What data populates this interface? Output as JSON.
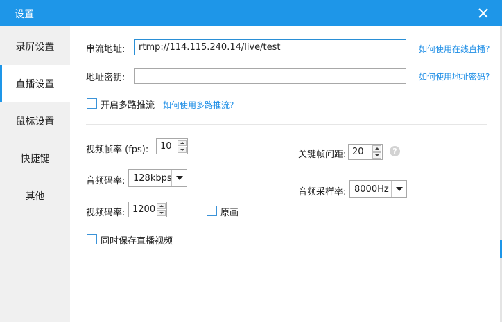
{
  "window": {
    "title": "设置"
  },
  "sidebar": {
    "items": [
      {
        "label": "录屏设置",
        "active": false
      },
      {
        "label": "直播设置",
        "active": true
      },
      {
        "label": "鼠标设置",
        "active": false
      },
      {
        "label": "快捷键",
        "active": false
      },
      {
        "label": "其他",
        "active": false
      }
    ]
  },
  "live": {
    "stream_url_label": "串流地址:",
    "stream_url_value": "rtmp://114.115.240.14/live/test",
    "stream_url_help": "如何使用在线直播?",
    "key_label": "地址密钥:",
    "key_value": "",
    "key_help": "如何使用地址密码?",
    "multi_push_label": "开启多路推流",
    "multi_push_checked": false,
    "multi_push_help": "如何使用多路推流?"
  },
  "video": {
    "fps_label": "视频帧率 (fps):",
    "fps_value": "10",
    "keyframe_label": "关键帧间距:",
    "keyframe_value": "20",
    "audio_bitrate_label": "音频码率:",
    "audio_bitrate_value": "128kbps",
    "audio_samplerate_label": "音频采样率:",
    "audio_samplerate_value": "8000Hz",
    "video_bitrate_label": "视频码率:",
    "video_bitrate_value": "1200",
    "original_label": "原画",
    "original_checked": false,
    "save_live_label": "同时保存直播视频",
    "save_live_checked": false
  },
  "colors": {
    "accent": "#1e96e8",
    "link": "#1e8ee6",
    "sidebar_bg": "#f0f0f0"
  }
}
